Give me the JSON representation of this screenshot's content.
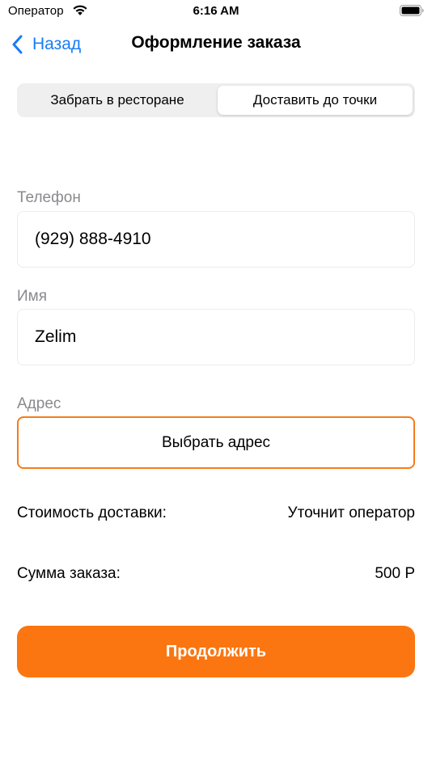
{
  "status_bar": {
    "carrier": "Оператор",
    "time": "6:16 AM",
    "wifi_icon": "wifi-icon",
    "battery_icon": "battery-icon"
  },
  "nav": {
    "back_label": "Назад",
    "back_icon": "chevron-left-icon",
    "title": "Оформление заказа"
  },
  "delivery_mode": {
    "options": [
      "Забрать в ресторане",
      "Доставить до точки"
    ],
    "selected": "Доставить до точки"
  },
  "form": {
    "phone": {
      "label": "Телефон",
      "value": "(929) 888-4910"
    },
    "name": {
      "label": "Имя",
      "value": "Zelim"
    },
    "address": {
      "label": "Адрес",
      "button_label": "Выбрать адрес"
    }
  },
  "summary": {
    "delivery_cost_label": "Стоимость доставки:",
    "delivery_cost_value": "Уточнит оператор",
    "order_total_label": "Сумма заказа:",
    "order_total_value": "500 Р"
  },
  "actions": {
    "continue_label": "Продолжить"
  },
  "colors": {
    "accent": "#fb7611",
    "link": "#1a7cf6",
    "label_gray": "#8a8a8e"
  }
}
